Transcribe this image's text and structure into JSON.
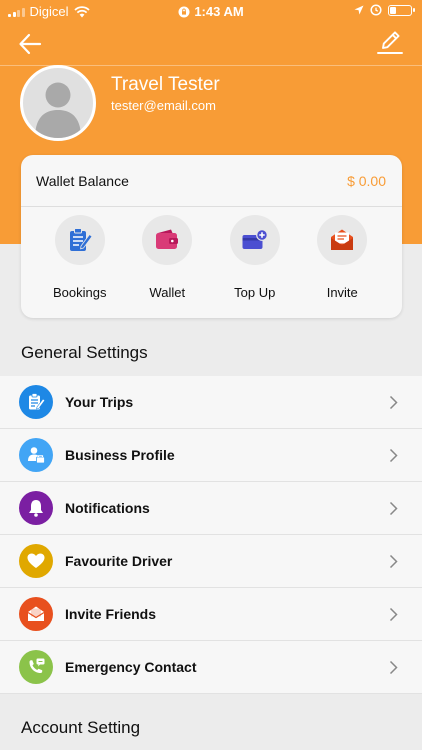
{
  "status_bar": {
    "carrier": "Digicel",
    "time": "1:43 AM"
  },
  "header": {
    "back_icon": "arrow-left-icon",
    "edit_icon": "pencil-icon",
    "accent_color": "#f89c36"
  },
  "profile": {
    "name": "Travel Tester",
    "email": "tester@email.com"
  },
  "wallet": {
    "label": "Wallet Balance",
    "amount": "$ 0.00",
    "actions": [
      {
        "label": "Bookings",
        "icon": "clipboard-icon"
      },
      {
        "label": "Wallet",
        "icon": "wallet-icon"
      },
      {
        "label": "Top Up",
        "icon": "card-plus-icon"
      },
      {
        "label": "Invite",
        "icon": "envelope-icon"
      }
    ]
  },
  "general_settings": {
    "title": "General Settings",
    "items": [
      {
        "label": "Your Trips",
        "icon": "clipboard-icon",
        "color": "#1e88e5"
      },
      {
        "label": "Business Profile",
        "icon": "business-person-icon",
        "color": "#42a5f5"
      },
      {
        "label": "Notifications",
        "icon": "bell-icon",
        "color": "#7b1fa2"
      },
      {
        "label": "Favourite Driver",
        "icon": "heart-icon",
        "color": "#e0a800"
      },
      {
        "label": "Invite Friends",
        "icon": "envelope-icon",
        "color": "#e8501e"
      },
      {
        "label": "Emergency Contact",
        "icon": "phone-chat-icon",
        "color": "#8bc34a"
      }
    ]
  },
  "account_setting": {
    "title": "Account Setting"
  }
}
